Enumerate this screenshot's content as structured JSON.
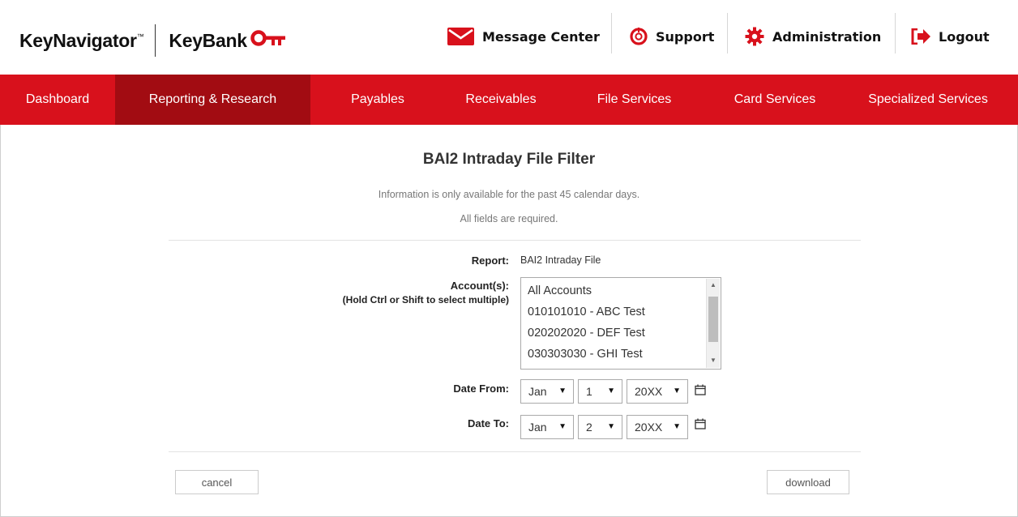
{
  "brand": {
    "product": "KeyNavigator",
    "tm": "™",
    "bank": "KeyBank"
  },
  "utility": {
    "message_center": "Message Center",
    "support": "Support",
    "administration": "Administration",
    "logout": "Logout"
  },
  "nav": [
    {
      "label": "Dashboard",
      "active": false
    },
    {
      "label": "Reporting & Research",
      "active": true
    },
    {
      "label": "Payables",
      "active": false
    },
    {
      "label": "Receivables",
      "active": false
    },
    {
      "label": "File Services",
      "active": false
    },
    {
      "label": "Card Services",
      "active": false
    },
    {
      "label": "Specialized Services",
      "active": false
    }
  ],
  "page": {
    "title": "BAI2 Intraday File Filter",
    "info": "Information is only available for the past 45 calendar days.",
    "required": "All fields are required."
  },
  "form": {
    "report_label": "Report:",
    "report_value": "BAI2 Intraday File",
    "accounts_label": "Account(s):",
    "accounts_hint": "(Hold Ctrl or Shift to select multiple)",
    "accounts": [
      "All Accounts",
      "010101010 - ABC Test",
      "020202020 - DEF Test",
      "030303030 - GHI Test"
    ],
    "date_from_label": "Date From:",
    "date_from": {
      "month": "Jan",
      "day": "1",
      "year": "20XX"
    },
    "date_to_label": "Date To:",
    "date_to": {
      "month": "Jan",
      "day": "2",
      "year": "20XX"
    }
  },
  "buttons": {
    "cancel": "cancel",
    "download": "download"
  },
  "colors": {
    "brand_red": "#d8111c",
    "active_nav": "#a20c12"
  },
  "icons": {
    "message_center": "envelope-icon",
    "support": "lifebuoy-icon",
    "administration": "gear-icon",
    "logout": "logout-arrow-icon",
    "calendar": "calendar-icon"
  }
}
